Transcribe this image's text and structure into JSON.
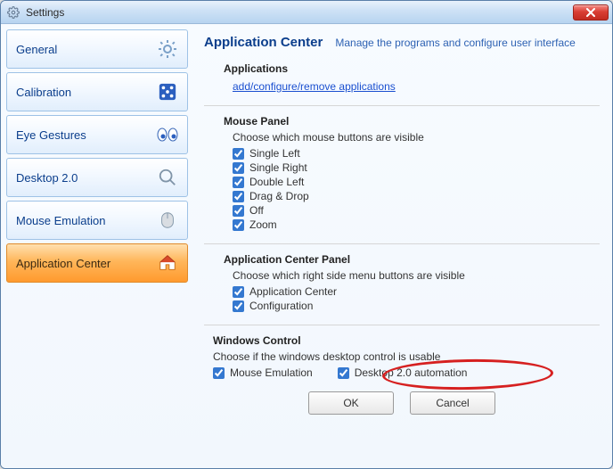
{
  "window": {
    "title": "Settings"
  },
  "sidebar": {
    "items": [
      {
        "label": "General"
      },
      {
        "label": "Calibration"
      },
      {
        "label": "Eye Gestures"
      },
      {
        "label": "Desktop 2.0"
      },
      {
        "label": "Mouse Emulation"
      },
      {
        "label": "Application Center"
      }
    ]
  },
  "header": {
    "title": "Application Center",
    "subtitle": "Manage the programs and configure user interface"
  },
  "applications": {
    "heading": "Applications",
    "link": "add/configure/remove applications"
  },
  "mouse_panel": {
    "heading": "Mouse Panel",
    "desc": "Choose which mouse buttons are visible",
    "options": [
      {
        "label": "Single Left"
      },
      {
        "label": "Single Right"
      },
      {
        "label": "Double Left"
      },
      {
        "label": "Drag & Drop"
      },
      {
        "label": "Off"
      },
      {
        "label": "Zoom"
      }
    ]
  },
  "acp": {
    "heading": "Application Center Panel",
    "desc": "Choose which right side menu buttons are visible",
    "options": [
      {
        "label": "Application Center"
      },
      {
        "label": "Configuration"
      }
    ]
  },
  "windows_control": {
    "heading": "Windows Control",
    "desc": "Choose if the windows desktop control is usable",
    "opt1": "Mouse Emulation",
    "opt2": "Desktop 2.0 automation"
  },
  "buttons": {
    "ok": "OK",
    "cancel": "Cancel"
  }
}
